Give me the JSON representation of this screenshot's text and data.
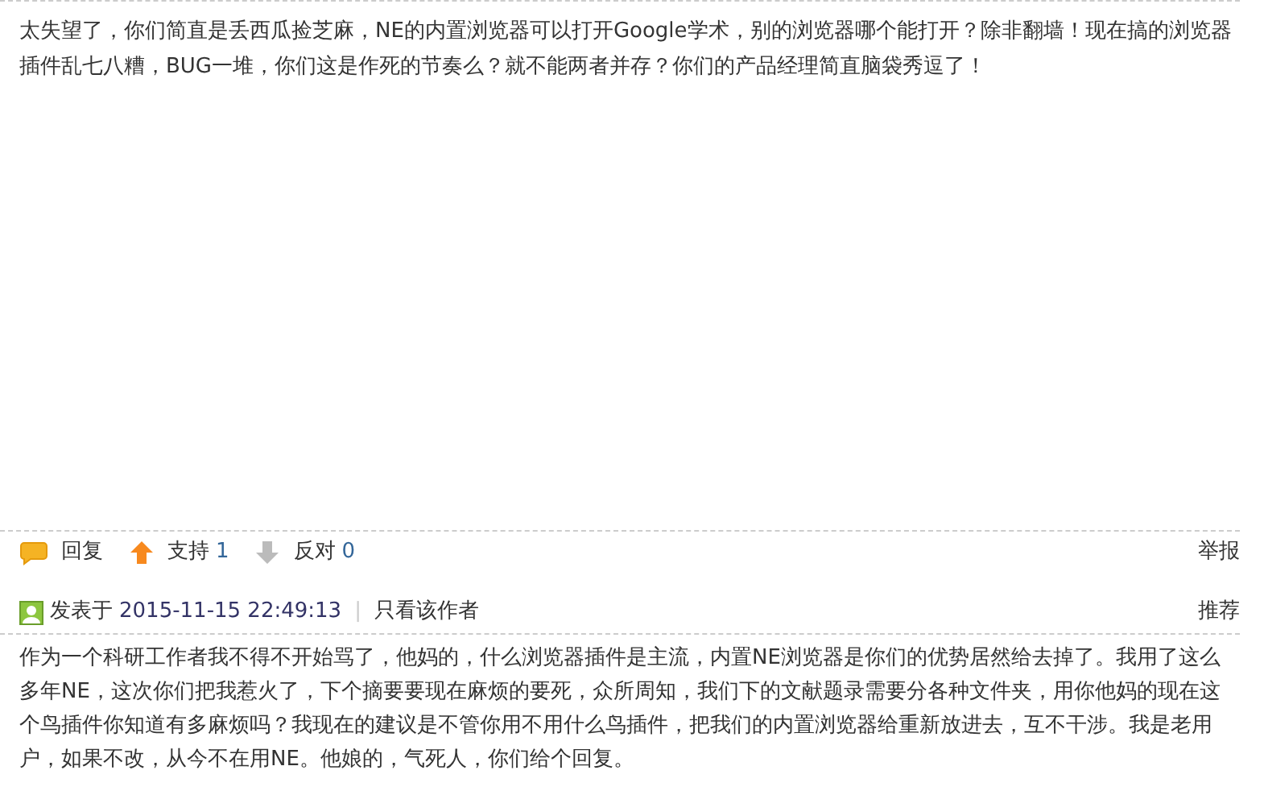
{
  "post": {
    "text": "太失望了，你们简直是丢西瓜捡芝麻，NE的内置浏览器可以打开Google学术，别的浏览器哪个能打开？除非翻墙！现在搞的浏览器插件乱七八糟，BUG一堆，你们这是作死的节奏么？就不能两者并存？你们的产品经理简直脑袋秀逗了！"
  },
  "actions": {
    "reply": "回复",
    "support": {
      "label": "支持",
      "count": "1"
    },
    "oppose": {
      "label": "反对",
      "count": "0"
    },
    "report": "举报"
  },
  "meta": {
    "posted_label": "发表于",
    "datetime": "2015-11-15 22:49:13",
    "separator": "|",
    "author_only": "只看该作者",
    "recommend": "推荐"
  },
  "next_post": {
    "text": "作为一个科研工作者我不得不开始骂了，他妈的，什么浏览器插件是主流，内置NE浏览器是你们的优势居然给去掉了。我用了这么多年NE，这次你们把我惹火了，下个摘要要现在麻烦的要死，众所周知，我们下的文献题录需要分各种文件夹，用你他妈的现在这个鸟插件你知道有多麻烦吗？我现在的建议是不管你用不用什么鸟插件，把我们的内置浏览器给重新放进去，互不干涉。我是老用户，如果不改，从今不在用NE。他娘的，气死人，你们给个回复。"
  }
}
